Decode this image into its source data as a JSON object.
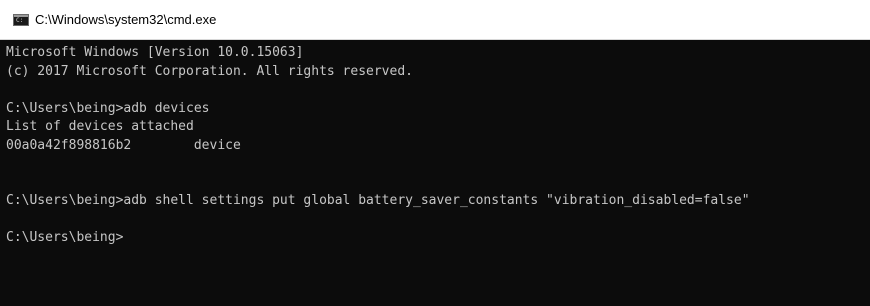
{
  "window": {
    "title": "C:\\Windows\\system32\\cmd.exe",
    "icon": "cmd-console-icon"
  },
  "console": {
    "lines": [
      "Microsoft Windows [Version 10.0.15063]",
      "(c) 2017 Microsoft Corporation. All rights reserved.",
      "",
      "C:\\Users\\being>adb devices",
      "List of devices attached",
      "00a0a42f898816b2        device",
      "",
      "",
      "C:\\Users\\being>adb shell settings put global battery_saver_constants \"vibration_disabled=false\"",
      "",
      "C:\\Users\\being>"
    ]
  }
}
